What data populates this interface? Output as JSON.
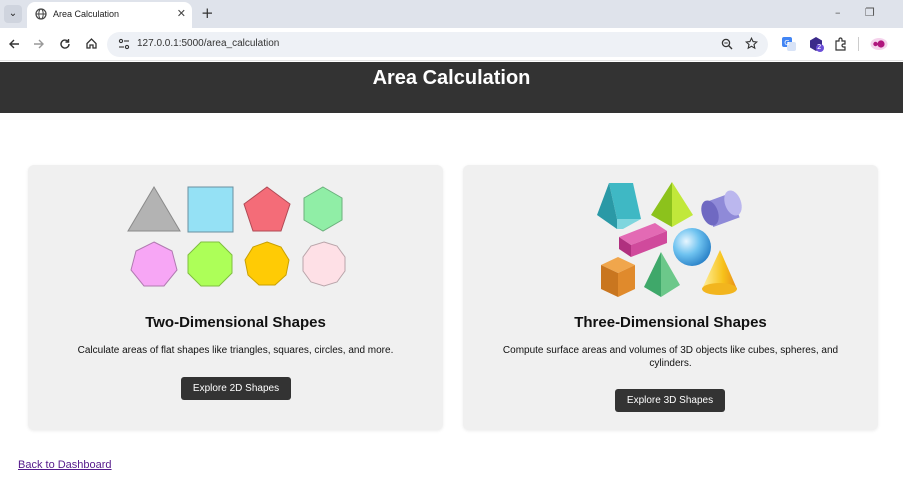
{
  "browser": {
    "tab_title": "Area Calculation",
    "tab_close": "✕",
    "new_tab": "+",
    "url": "127.0.0.1:5000/area_calculation",
    "window_controls": [
      "–",
      "❐"
    ],
    "icons": [
      "back-arrow-icon",
      "forward-arrow-icon",
      "reload-icon",
      "home-icon",
      "site-info-icon",
      "zoom-icon",
      "bookmark-star-icon",
      "translate-icon",
      "extension-badge-icon",
      "puzzle-icon",
      "profile-icon"
    ],
    "extension_badge_count": "2"
  },
  "header": {
    "title": "Area Calculation"
  },
  "cards": [
    {
      "title": "Two-Dimensional Shapes",
      "description": "Calculate areas of flat shapes like triangles, squares, circles, and more.",
      "button": "Explore 2D Shapes"
    },
    {
      "title": "Three-Dimensional Shapes",
      "description": "Compute surface areas and volumes of 3D objects like cubes, spheres, and cylinders.",
      "button": "Explore 3D Shapes"
    }
  ],
  "footer": {
    "back_link": "Back to Dashboard"
  },
  "colors": {
    "header_bg": "#333333",
    "card_bg": "#f0f0f0",
    "button_bg": "#333333",
    "link": "#551a8b",
    "shapes_2d": [
      "#b3b3b3",
      "#95e1f5",
      "#f46c78",
      "#90eea6",
      "#f7a6f5",
      "#adff58",
      "#ffcb05",
      "#fee0e6"
    ]
  }
}
